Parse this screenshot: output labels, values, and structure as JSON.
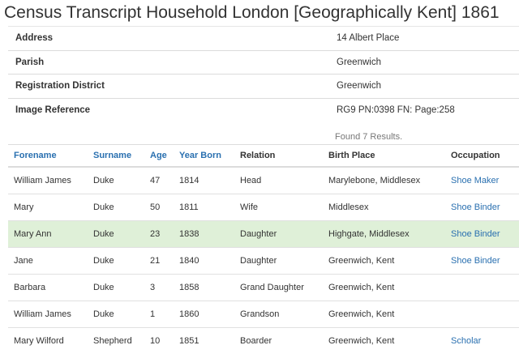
{
  "title": "Census Transcript Household London [Geographically Kent] 1861",
  "info": [
    {
      "label": "Address",
      "value": "14 Albert Place"
    },
    {
      "label": "Parish",
      "value": "Greenwich"
    },
    {
      "label": "Registration District",
      "value": "Greenwich"
    },
    {
      "label": "Image Reference",
      "value": "RG9 PN:0398 FN: Page:258"
    }
  ],
  "results_count_text": "Found 7 Results.",
  "columns": [
    "Forename",
    "Surname",
    "Age",
    "Year Born",
    "Relation",
    "Birth Place",
    "Occupation"
  ],
  "rows": [
    [
      "William James",
      "Duke",
      "47",
      "1814",
      "Head",
      "Marylebone, Middlesex",
      "Shoe Maker"
    ],
    [
      "Mary",
      "Duke",
      "50",
      "1811",
      "Wife",
      "Middlesex",
      "Shoe Binder"
    ],
    [
      "Mary Ann",
      "Duke",
      "23",
      "1838",
      "Daughter",
      "Highgate, Middlesex",
      "Shoe Binder"
    ],
    [
      "Jane",
      "Duke",
      "21",
      "1840",
      "Daughter",
      "Greenwich, Kent",
      "Shoe Binder"
    ],
    [
      "Barbara",
      "Duke",
      "3",
      "1858",
      "Grand Daughter",
      "Greenwich, Kent",
      ""
    ],
    [
      "William James",
      "Duke",
      "1",
      "1860",
      "Grandson",
      "Greenwich, Kent",
      ""
    ],
    [
      "Mary Wilford",
      "Shepherd",
      "10",
      "1851",
      "Boarder",
      "Greenwich, Kent",
      "Scholar"
    ]
  ],
  "highlight_color": "#dff0d8",
  "link_color": "#2a70b0"
}
